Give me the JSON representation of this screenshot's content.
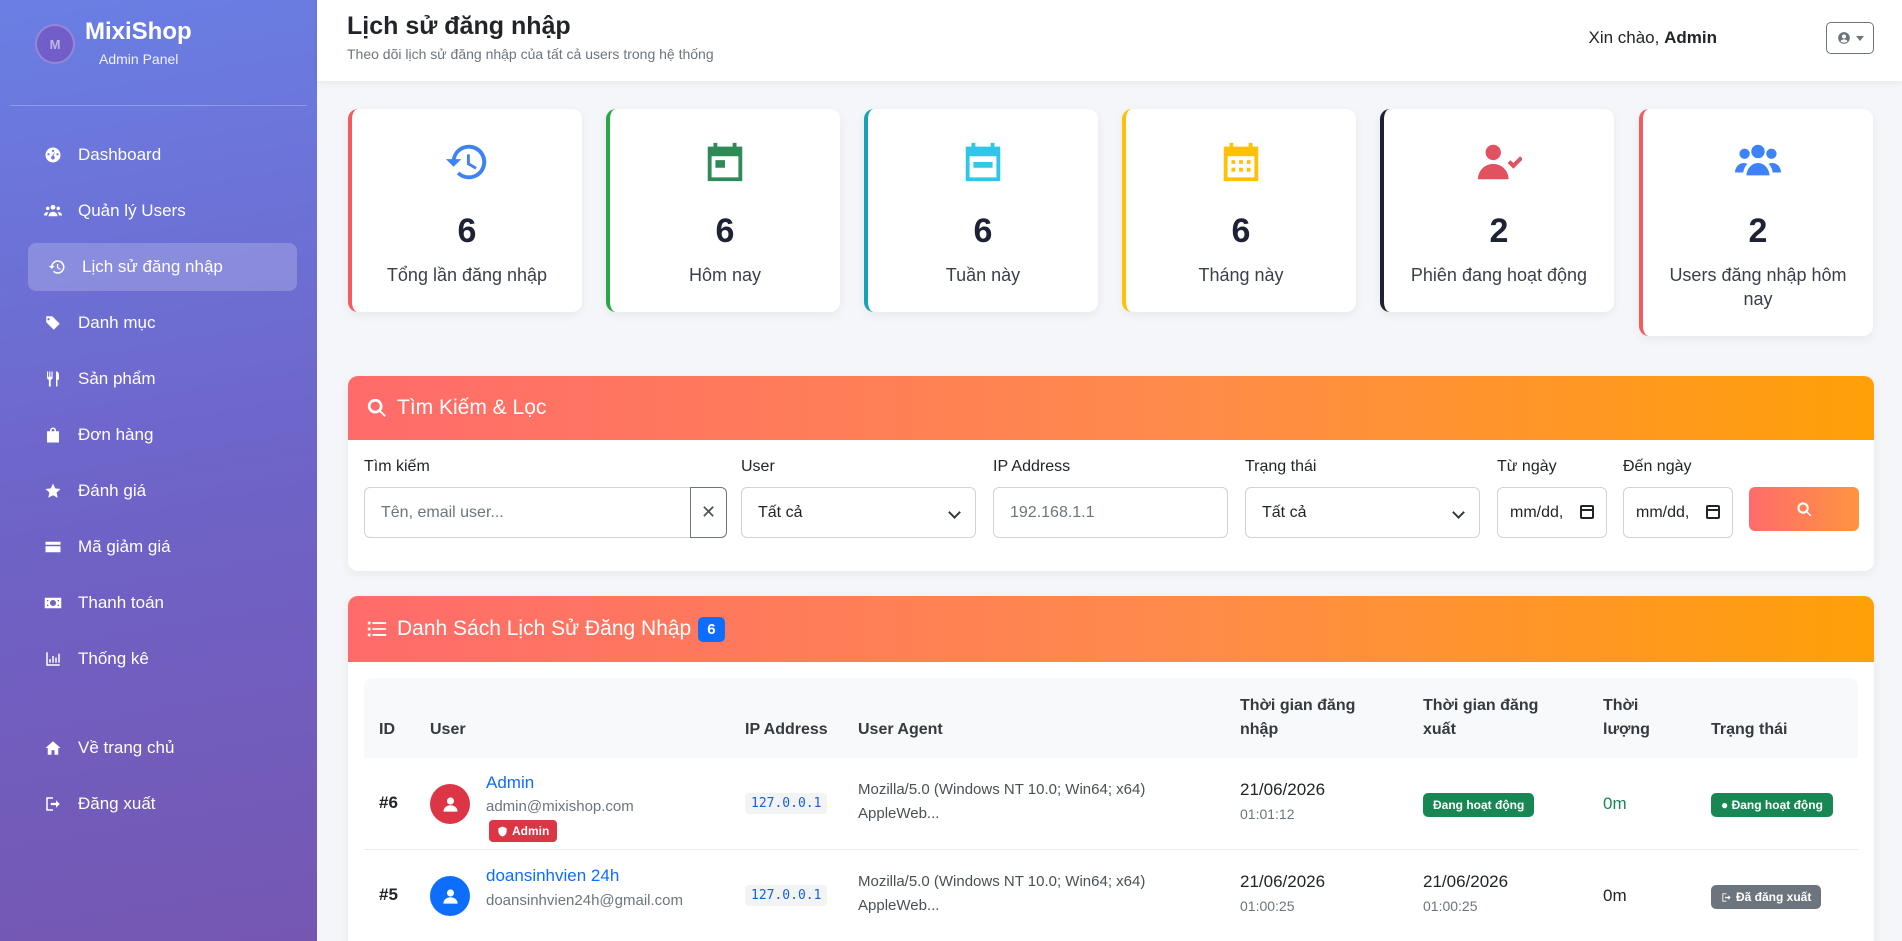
{
  "brand": {
    "name": "MixiShop",
    "subtitle": "Admin Panel",
    "logo_letter": "M"
  },
  "sidebar": {
    "items": [
      {
        "label": "Dashboard",
        "icon": "dashboard-icon"
      },
      {
        "label": "Quản lý Users",
        "icon": "users-icon"
      },
      {
        "label": "Lịch sử đăng nhập",
        "icon": "history-icon",
        "active": true
      },
      {
        "label": "Danh mục",
        "icon": "tags-icon"
      },
      {
        "label": "Sản phẩm",
        "icon": "utensils-icon"
      },
      {
        "label": "Đơn hàng",
        "icon": "shopping-bag-icon"
      },
      {
        "label": "Đánh giá",
        "icon": "star-icon"
      },
      {
        "label": "Mã giảm giá",
        "icon": "credit-card-icon"
      },
      {
        "label": "Thanh toán",
        "icon": "money-icon"
      },
      {
        "label": "Thống kê",
        "icon": "chart-icon"
      }
    ],
    "bottom_items": [
      {
        "label": "Về trang chủ",
        "icon": "home-icon"
      },
      {
        "label": "Đăng xuất",
        "icon": "logout-icon"
      }
    ]
  },
  "header": {
    "title": "Lịch sử đăng nhập",
    "subtitle": "Theo dõi lịch sử đăng nhập của tất cả users trong hệ thống",
    "greeting": "Xin chào,",
    "username": "Admin"
  },
  "stats": [
    {
      "value": "6",
      "label": "Tổng lần đăng nhập",
      "color": "#f25c5c",
      "icon": "history-icon",
      "icon_color": "#3d82f6"
    },
    {
      "value": "6",
      "label": "Hôm nay",
      "color": "#28a745",
      "icon": "calendar-day-icon",
      "icon_color": "#2e8b57"
    },
    {
      "value": "6",
      "label": "Tuần này",
      "color": "#17a2b8",
      "icon": "calendar-week-icon",
      "icon_color": "#2fc6e8"
    },
    {
      "value": "6",
      "label": "Tháng này",
      "color": "#ffc107",
      "icon": "calendar-month-icon",
      "icon_color": "#ffc107"
    },
    {
      "value": "2",
      "label": "Phiên đang hoạt động",
      "color": "#1e2235",
      "icon": "user-check-icon",
      "icon_color": "#e05260"
    },
    {
      "value": "2",
      "label": "Users đăng nhập hôm nay",
      "color": "#f25c5c",
      "icon": "users-icon",
      "icon_color": "#3d82f6"
    }
  ],
  "filter": {
    "title": "Tìm Kiếm & Lọc",
    "search_label": "Tìm kiếm",
    "search_placeholder": "Tên, email user...",
    "clear_symbol": "✕",
    "user_label": "User",
    "user_value": "Tất cả",
    "ip_label": "IP Address",
    "ip_placeholder": "192.168.1.1",
    "status_label": "Trạng thái",
    "status_value": "Tất cả",
    "from_label": "Từ ngày",
    "from_value": "mm/dd,",
    "to_label": "Đến ngày",
    "to_value": "mm/dd,"
  },
  "table": {
    "title": "Danh Sách Lịch Sử Đăng Nhập",
    "count": "6",
    "columns": {
      "id": "ID",
      "user": "User",
      "ip": "IP Address",
      "ua": "User Agent",
      "login": "Thời gian đăng nhập",
      "logout": "Thời gian đăng xuất",
      "duration": "Thời lượng",
      "status": "Trạng thái"
    },
    "rows": [
      {
        "id": "#6",
        "name": "Admin",
        "email": "admin@mixishop.com",
        "role": "Admin",
        "avatar_color": "#dc3545",
        "ip": "127.0.0.1",
        "ua_line1": "Mozilla/5.0 (Windows NT 10.0; Win64; x64)",
        "ua_line2": "AppleWeb...",
        "login_date": "21/06/2026",
        "login_time": "01:01:12",
        "logout_badge": "Đang hoạt động",
        "duration": "0m",
        "duration_color": "#198754",
        "status": "Đang hoạt động"
      },
      {
        "id": "#5",
        "name": "doansinhvien 24h",
        "email": "doansinhvien24h@gmail.com",
        "avatar_color": "#0d6efd",
        "ip": "127.0.0.1",
        "ua_line1": "Mozilla/5.0 (Windows NT 10.0; Win64; x64)",
        "ua_line2": "AppleWeb...",
        "login_date": "21/06/2026",
        "login_time": "01:00:25",
        "logout_date": "21/06/2026",
        "logout_time": "01:00:25",
        "duration": "0m",
        "duration_color": "#212529",
        "status": "Đã đăng xuất"
      }
    ]
  }
}
